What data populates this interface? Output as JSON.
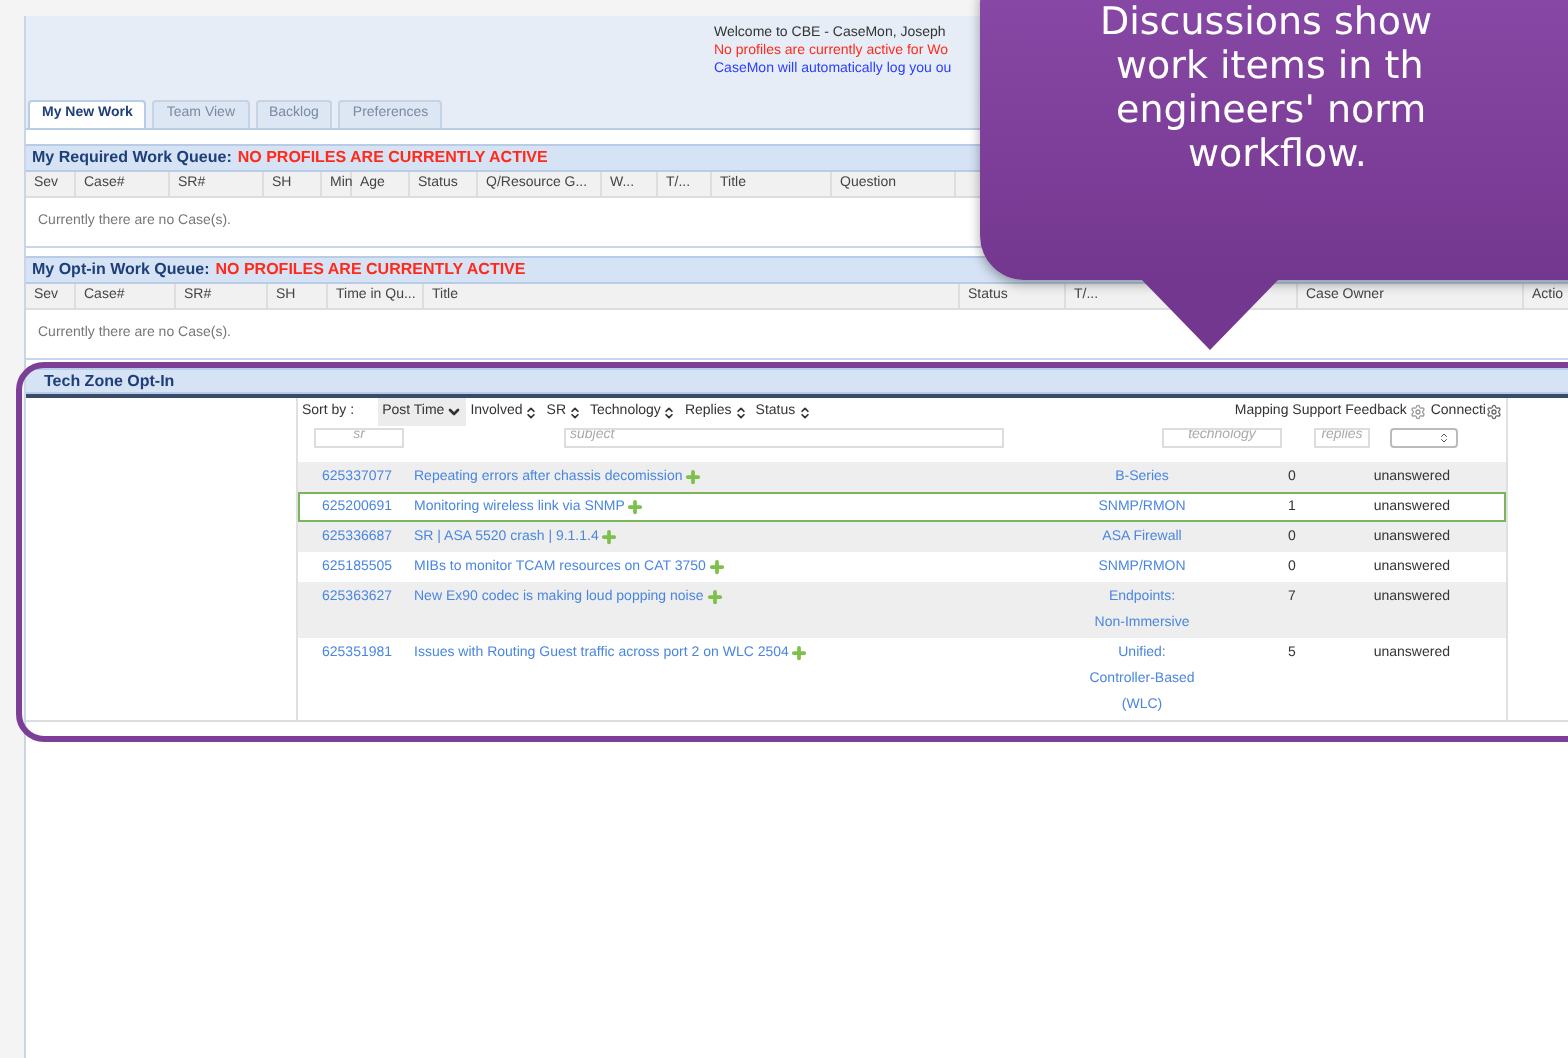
{
  "header": {
    "welcome": "Welcome to CBE - CaseMon, Joseph",
    "warning": "No profiles are currently active for Wo",
    "notice": "CaseMon will automatically log you ou"
  },
  "tabs": [
    {
      "label": "My New Work",
      "selected": true
    },
    {
      "label": "Team View",
      "selected": false
    },
    {
      "label": "Backlog",
      "selected": false
    },
    {
      "label": "Preferences",
      "selected": false
    }
  ],
  "required_queue": {
    "title": "My Required Work Queue:",
    "alert": "NO PROFILES ARE CURRENTLY ACTIVE",
    "columns": [
      "Sev",
      "Case#",
      "SR#",
      "SH",
      "Min",
      "Age",
      "Status",
      "Q/Resource G...",
      "W...",
      "T/...",
      "Title",
      "Question"
    ],
    "empty_message": "Currently there are no Case(s)."
  },
  "optin_queue": {
    "title": "My Opt-in Work Queue:",
    "alert": "NO PROFILES ARE CURRENTLY ACTIVE",
    "columns": [
      "Sev",
      "Case#",
      "SR#",
      "SH",
      "Time in Qu...",
      "Title",
      "Status",
      "T/...",
      "Case Owner",
      "Actio"
    ],
    "empty_message": "Currently there are no Case(s)."
  },
  "tech_zone": {
    "title": "Tech Zone Opt-In",
    "sort_label": "Sort by :",
    "sort_options": [
      {
        "label": "Post Time",
        "selected": true
      },
      {
        "label": "Involved",
        "selected": false
      },
      {
        "label": "SR",
        "selected": false
      },
      {
        "label": "Technology",
        "selected": false
      },
      {
        "label": "Replies",
        "selected": false
      },
      {
        "label": "Status",
        "selected": false
      }
    ],
    "links": [
      "Mapping Support Feedback",
      "Connecti"
    ],
    "filters": {
      "sr": {
        "placeholder": "sr"
      },
      "subject": {
        "placeholder": "subject"
      },
      "technology": {
        "placeholder": "technology"
      },
      "replies": {
        "placeholder": "replies"
      }
    },
    "rows": [
      {
        "sr": "625337077",
        "title": "Repeating errors after chassis decomission",
        "technology": [
          "B-Series"
        ],
        "replies": "0",
        "status": "unanswered",
        "selected": false
      },
      {
        "sr": "625200691",
        "title": "Monitoring wireless link via SNMP",
        "technology": [
          "SNMP/RMON"
        ],
        "replies": "1",
        "status": "unanswered",
        "selected": true
      },
      {
        "sr": "625336687",
        "title": "SR | ASA 5520 crash | 9.1.1.4",
        "technology": [
          "ASA Firewall"
        ],
        "replies": "0",
        "status": "unanswered",
        "selected": false
      },
      {
        "sr": "625185505",
        "title": "MIBs to monitor TCAM resources on CAT 3750",
        "technology": [
          "SNMP/RMON"
        ],
        "replies": "0",
        "status": "unanswered",
        "selected": false
      },
      {
        "sr": "625363627",
        "title": "New Ex90 codec is making loud popping noise",
        "technology": [
          "Endpoints:",
          "Non-Immersive"
        ],
        "replies": "7",
        "status": "unanswered",
        "selected": false
      },
      {
        "sr": "625351981",
        "title": "Issues with Routing Guest traffic across port 2 on WLC 2504",
        "technology": [
          "Unified:",
          "Controller-Based",
          "(WLC)"
        ],
        "replies": "5",
        "status": "unanswered",
        "selected": false
      }
    ]
  },
  "callout": {
    "lines": [
      "Discussions show",
      "work items in th",
      "engineers' norm",
      "workflow."
    ]
  }
}
